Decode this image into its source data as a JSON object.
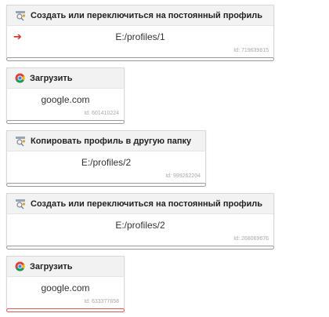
{
  "blocks": [
    {
      "title": "Создать или переключиться на постоянный профиль",
      "icon": "profile-switch-icon",
      "value": "E:/profiles/1",
      "id_label": "Id: 719639815",
      "active": true
    },
    {
      "title": "Загрузить",
      "icon": "chrome-icon",
      "value": "google.com",
      "id_label": "Id: 601410224",
      "active": false
    },
    {
      "title": "Копировать профиль в другую папку",
      "icon": "profile-copy-icon",
      "value": "E:/profiles/2",
      "id_label": "Id: 999262204",
      "active": false
    },
    {
      "title": "Создать или переключиться на постоянный профиль",
      "icon": "profile-switch-icon",
      "value": "E:/profiles/2",
      "id_label": "Id: 268069676",
      "active": false
    },
    {
      "title": "Загрузить",
      "icon": "chrome-icon",
      "value": "google.com",
      "id_label": "Id: 633377658",
      "active": false
    }
  ],
  "colors": {
    "active_arrow": "#d32f2f",
    "error_bar": "#e05555"
  }
}
